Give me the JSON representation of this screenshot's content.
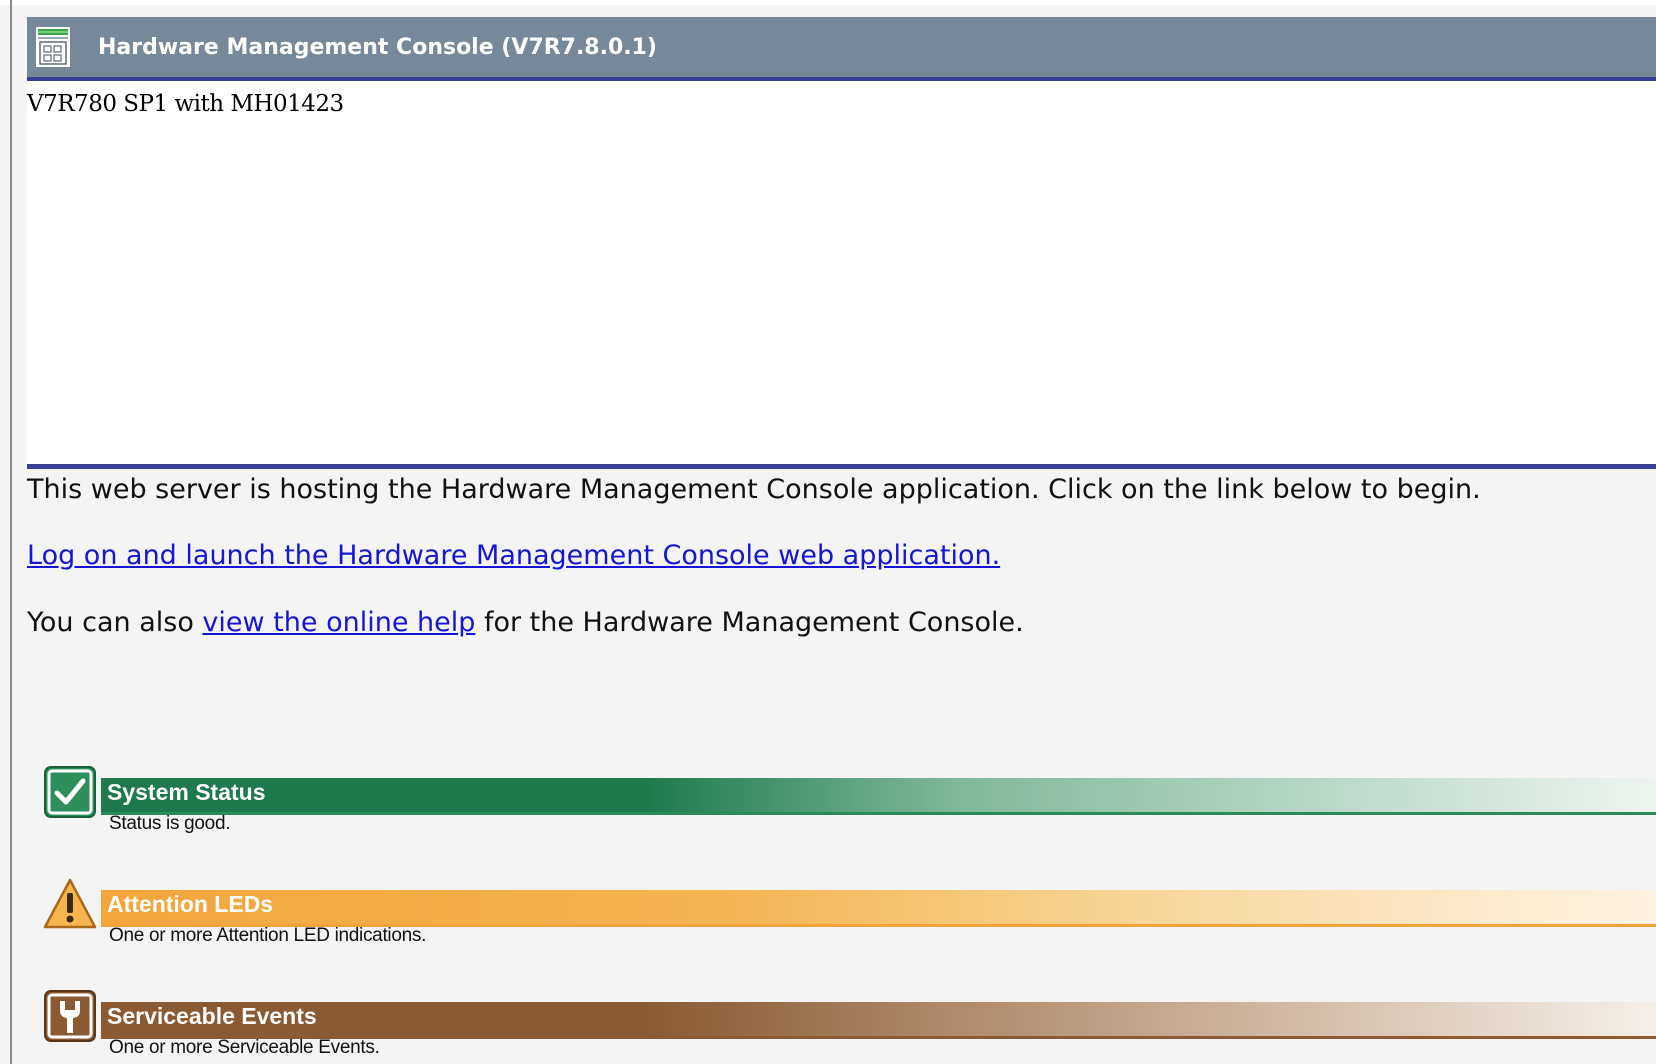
{
  "header": {
    "title": "Hardware Management Console (V7R7.8.0.1)",
    "icon": "console-window-icon"
  },
  "version": {
    "text": "V7R780 SP1 with MH01423"
  },
  "intro": {
    "text": "This web server is hosting the Hardware Management Console application.  Click on the link below to begin."
  },
  "launch_link": {
    "text": "Log on and launch the Hardware Management Console web application."
  },
  "help_line": {
    "prefix": "You can also ",
    "link": "view the online help",
    "suffix": " for the Hardware Management Console."
  },
  "statuses": [
    {
      "title": "System Status",
      "description": "Status is good.",
      "icon": "checkmark-icon",
      "color": "#2a8055"
    },
    {
      "title": "Attention LEDs",
      "description": "One or more Attention LED indications.",
      "icon": "warning-icon",
      "color": "#f0a33a"
    },
    {
      "title": "Serviceable Events",
      "description": "One or more Serviceable Events.",
      "icon": "wrench-icon",
      "color": "#8b5a32"
    }
  ]
}
